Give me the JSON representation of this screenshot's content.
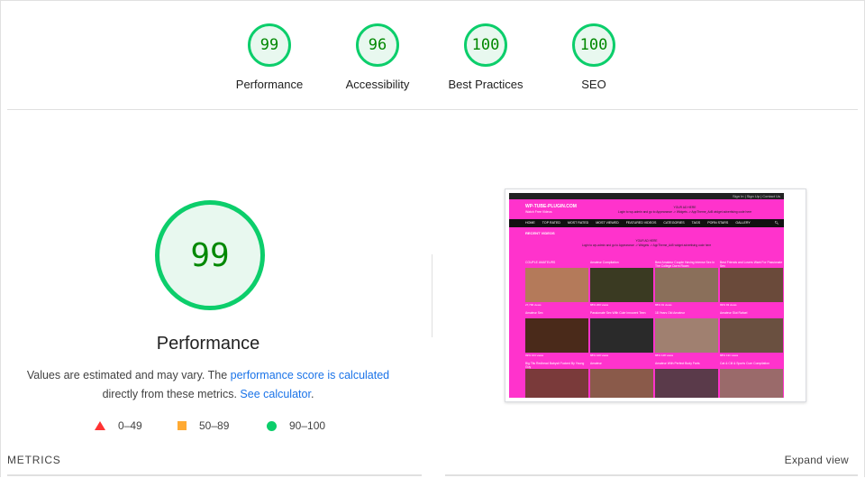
{
  "gauges": [
    {
      "score": "99",
      "label": "Performance",
      "color": "#0cce6b"
    },
    {
      "score": "96",
      "label": "Accessibility",
      "color": "#0cce6b"
    },
    {
      "score": "100",
      "label": "Best Practices",
      "color": "#0cce6b"
    },
    {
      "score": "100",
      "label": "SEO",
      "color": "#0cce6b"
    }
  ],
  "main": {
    "score": "99",
    "title": "Performance",
    "desc_prefix": "Values are estimated and may vary. The ",
    "desc_link1": "performance score is calculated",
    "desc_middle": " directly from these metrics. ",
    "desc_link2": "See calculator",
    "desc_suffix": "."
  },
  "legend": [
    {
      "range": "0–49",
      "shape": "triangle",
      "color": "#ff3333"
    },
    {
      "range": "50–89",
      "shape": "square",
      "color": "#ffaa33"
    },
    {
      "range": "90–100",
      "shape": "circle",
      "color": "#0cce6b"
    }
  ],
  "footer": {
    "metrics_label": "METRICS",
    "expand_label": "Expand view"
  },
  "screenshot": {
    "topbar": "Sign In | Sign Up | Contact Us",
    "logo": "WP-TUBE-PLUGIN.COM",
    "tagline": "Watch Free Videos",
    "header_text": "YOUR AD HERE",
    "header_subtext": "Login to wp-admin and go to Appearance -> Widgets -> AppTheme_Ad5 widget advertising code here",
    "nav": [
      "HOME",
      "TOP RATED",
      "MOST RATED",
      "MOST VIEWED",
      "FEATURED VIDEOS",
      "CATEGORIES",
      "TAGS",
      "PORN STARS",
      "GALLERY"
    ],
    "section": "RECENT VIDEOS",
    "note_title": "YOUR AD HERE",
    "note_text": "Login to wp-admin and go to Appearance -> Widgets -> AppTheme_Ad5 widget advertising code here",
    "videos": [
      {
        "title": "COUPLE AMATEURS",
        "meta": "27,790 views",
        "thumb": "#b47a5a"
      },
      {
        "title": "Amateur Compilation",
        "meta": "88% 200 views",
        "thumb": "#3a3a22"
      },
      {
        "title": "Best Amateur Couple Having Intense Sex In The College Dorm Room",
        "meta": "88% 91 views",
        "thumb": "#8a6f5a"
      },
      {
        "title": "Best Friends and Lovers Want For Passionate Sex",
        "meta": "99% 93 views",
        "thumb": "#6a4a3a"
      },
      {
        "title": "Amateur Sex",
        "meta": "99% 104 views",
        "thumb": "#4a2a1a"
      },
      {
        "title": "Passionate Sex With Cute Innocent Teen",
        "meta": "88% 100 views",
        "thumb": "#2a2a2a"
      },
      {
        "title": "18 Years Old Amateur",
        "meta": "88% 128 views",
        "thumb": "#a08070"
      },
      {
        "title": "Amateur Slut Rafael",
        "meta": "88% 131 views",
        "thumb": "#6a5040"
      },
      {
        "title": "Big Tits Redhead Babysit Fucked By Young Guy",
        "meta": "",
        "thumb": "#7a3a3a"
      },
      {
        "title": "Amateur",
        "meta": "",
        "thumb": "#8a5a4a"
      },
      {
        "title": "Amateur With Perfect Body Farts",
        "meta": "",
        "thumb": "#5a3a4a"
      },
      {
        "title": "Cat & Cill & Sports Cum Compilation",
        "meta": "",
        "thumb": "#9a6a6a"
      }
    ]
  }
}
